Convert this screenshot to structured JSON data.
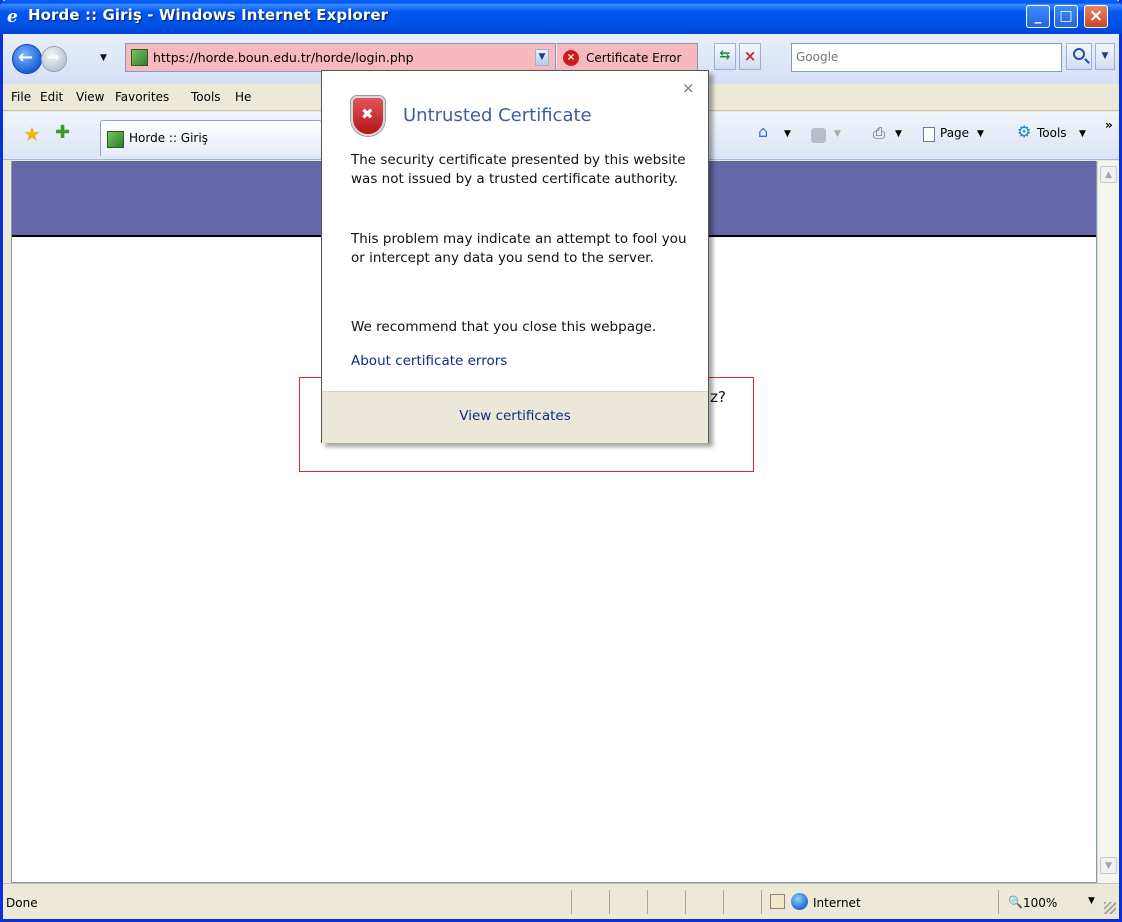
{
  "window": {
    "title": "Horde :: Giriş - Windows Internet Explorer"
  },
  "address_bar": {
    "url": "https://horde.boun.edu.tr/horde/login.php",
    "certificate_error_label": "Certificate Error",
    "search_placeholder": "Google"
  },
  "menu": {
    "items": [
      "File",
      "Edit",
      "View",
      "Favorites",
      "Tools",
      "He"
    ]
  },
  "tabs": [
    {
      "label": "Horde :: Giriş"
    }
  ],
  "command_bar": {
    "page_label": "Page",
    "tools_label": "Tools"
  },
  "page": {
    "partial_text": "iz?"
  },
  "certificate_popup": {
    "title": "Untrusted Certificate",
    "paragraph1": "The security certificate presented by this website was not issued by a trusted certificate authority.",
    "paragraph2": "This problem may indicate an attempt to fool you or intercept any data you send to the server.",
    "paragraph3": "We recommend that you close this webpage.",
    "link": "About certificate errors",
    "view_certificates": "View certificates"
  },
  "status_bar": {
    "text": "Done",
    "zone": "Internet",
    "zoom": "100%"
  },
  "colors": {
    "title_bar": "#0054E3",
    "address_error_bg": "#F7B8BE",
    "banner": "#6667A8",
    "highlight_box": "#E0262A",
    "popup_title": "#3D5EA0",
    "link": "#0E2A8C"
  }
}
